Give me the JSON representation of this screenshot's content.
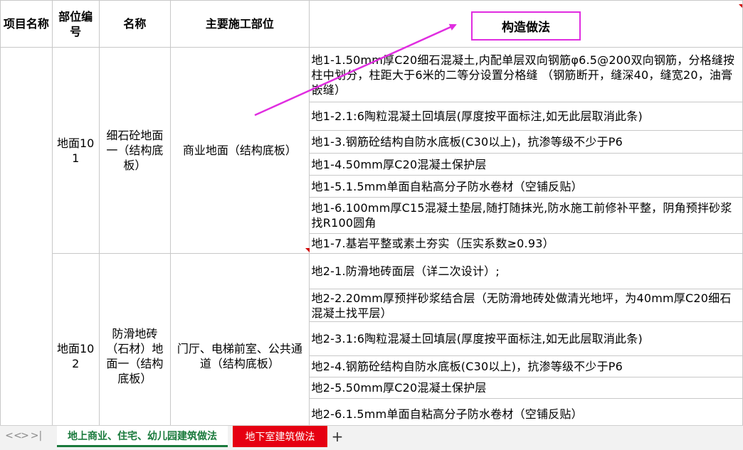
{
  "sheet": {
    "header": {
      "col1": "项目名称",
      "col2": "部位编号",
      "col3": "名称",
      "col4": "主要施工部位",
      "col5": "构造做法"
    },
    "groups": [
      {
        "code": "地面101",
        "name": "细石砼地面一（结构底板）",
        "location": "商业地面（结构底板）",
        "items": [
          "地1-1.50mm厚C20细石混凝土,内配单层双向钢筋φ6.5@200双向钢筋，分格缝按柱中划分，柱距大于6米的二等分设置分格缝 （钢筋断开，缝深40，缝宽20，油膏嵌缝）",
          "地1-2.1:6陶粒混凝土回填层(厚度按平面标注,如无此层取消此条)",
          "地1-3.钢筋砼结构自防水底板(C30以上)，抗渗等级不少于P6",
          "地1-4.50mm厚C20混凝土保护层",
          "地1-5.1.5mm单面自粘高分子防水卷材（空铺反贴）",
          "地1-6.100mm厚C15混凝土垫层,随打随抹光,防水施工前修补平整，阴角预拌砂浆找R100圆角",
          "地1-7.基岩平整或素土夯实（压实系数≥0.93）"
        ]
      },
      {
        "code": "地面102",
        "name": "防滑地砖（石材）地面一（结构底板）",
        "location": "门厅、电梯前室、公共通道（结构底板）",
        "items": [
          "地2-1.防滑地砖面层（详二次设计）;",
          "地2-2.20mm厚预拌砂浆结合层（无防滑地砖处做清光地坪，为40mm厚C20细石混凝土找平层）",
          "地2-3.1:6陶粒混凝土回填层(厚度按平面标注,如无此层取消此条)",
          "地2-4.钢筋砼结构自防水底板(C30以上)，抗渗等级不少于P6",
          "地2-5.50mm厚C20混凝土保护层",
          "地2-6.1.5mm单面自粘高分子防水卷材（空铺反贴）"
        ]
      }
    ]
  },
  "tabs": {
    "nav_first": "<",
    "nav_prev": "<",
    "nav_next": ">",
    "nav_last": ">|",
    "active": "地上商业、住宅、幼儿园建筑做法",
    "second": "地下室建筑做法",
    "add": "+"
  },
  "colors": {
    "highlight": "#e02de0",
    "tab_active_text": "#1a7a3c",
    "tab_red_bg": "#e60012",
    "grid": "#c8c8c8"
  }
}
